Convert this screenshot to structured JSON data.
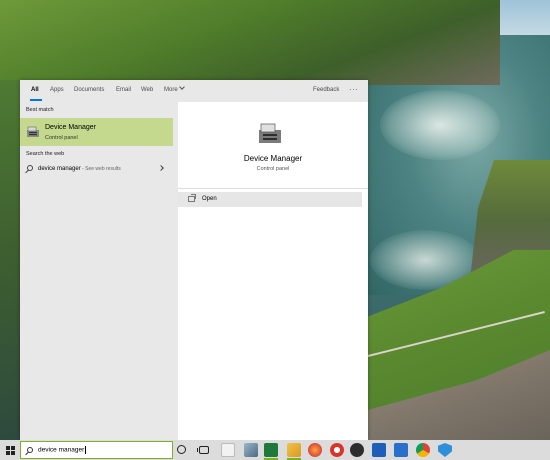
{
  "filters": {
    "tabs": [
      "All",
      "Apps",
      "Documents",
      "Email",
      "Web",
      "More"
    ],
    "feedback": "Feedback",
    "more_options": "···"
  },
  "results": {
    "best_match_label": "Best match",
    "best_match": {
      "title": "Device Manager",
      "subtitle": "Control panel"
    },
    "web_label": "Search the web",
    "web_item": {
      "query": "device manager",
      "suffix": " - See web results"
    }
  },
  "detail": {
    "title": "Device Manager",
    "subtitle": "Control panel",
    "actions": [
      "Open"
    ]
  },
  "taskbar": {
    "search_value": "device manager",
    "apps": [
      "file-explorer-icon",
      "photos-icon",
      "excel-icon",
      "folder-icon",
      "firefox-icon",
      "paint-icon",
      "media-icon",
      "outlook-icon",
      "mail-icon",
      "chrome-icon",
      "defender-icon"
    ]
  },
  "colors": {
    "highlight": "#c4d98e",
    "accent": "#0078d7",
    "search_border": "#7fae2d"
  }
}
